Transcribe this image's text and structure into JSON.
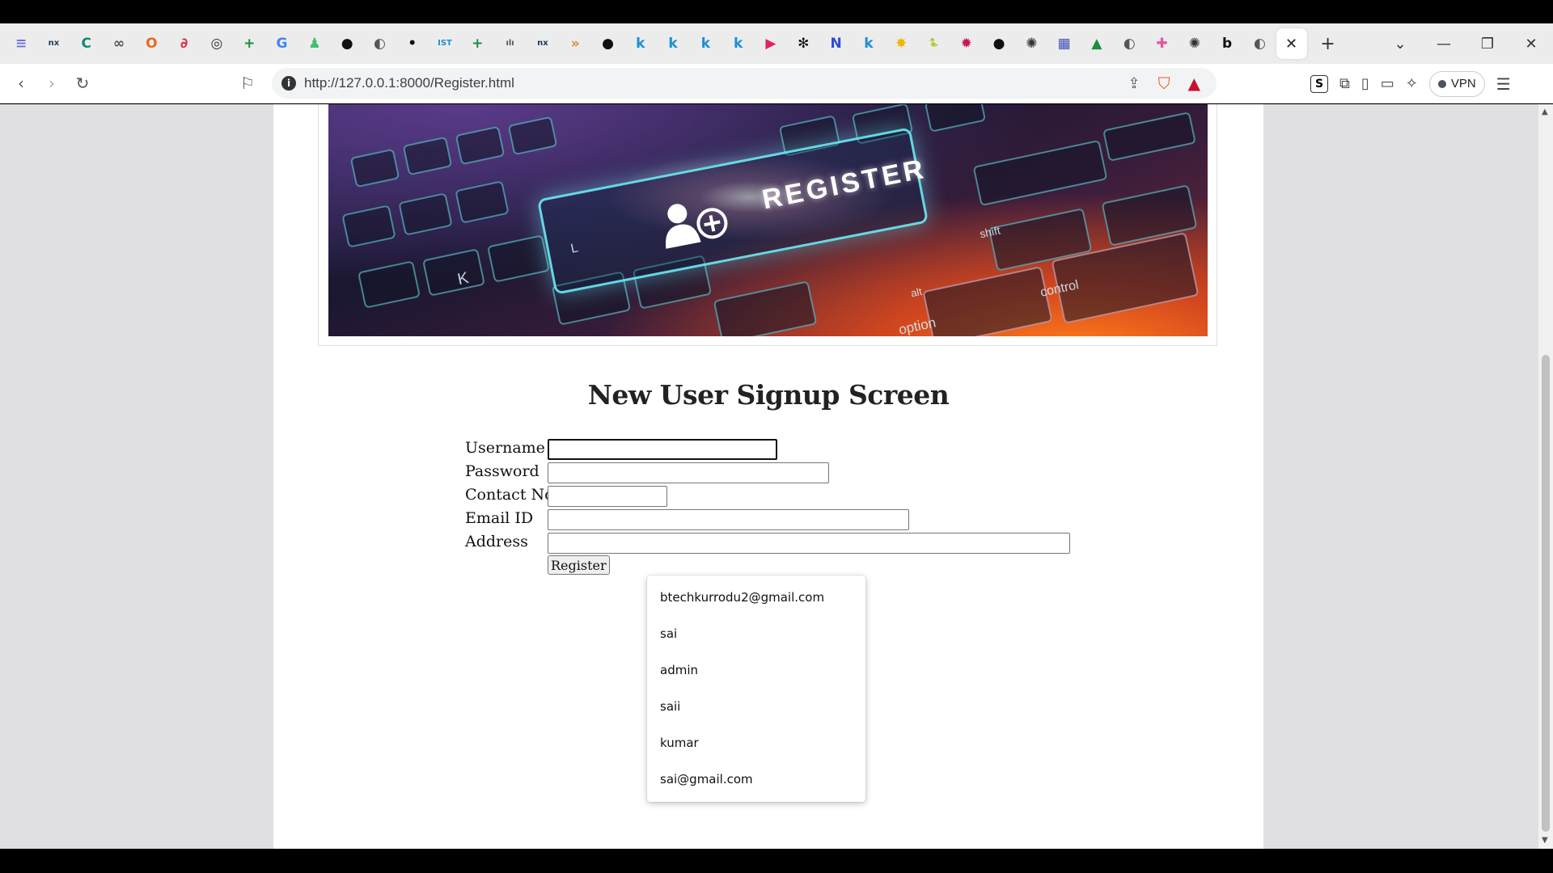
{
  "browser": {
    "url": "http://127.0.0.1:8000/Register.html",
    "vpn_label": "VPN",
    "tabs": [
      {
        "icon": "lines-icon",
        "color": "#6b73d8",
        "glyph": "≡"
      },
      {
        "icon": "nx-icon",
        "color": "#1d3a5a",
        "glyph": "nx"
      },
      {
        "icon": "c-icon",
        "color": "#0e8a74",
        "glyph": "C"
      },
      {
        "icon": "bike-icon",
        "color": "#555",
        "glyph": "∞"
      },
      {
        "icon": "office-icon",
        "color": "#e86a1f",
        "glyph": "O"
      },
      {
        "icon": "script-icon",
        "color": "#d62b3a",
        "glyph": "∂"
      },
      {
        "icon": "glasses-icon",
        "color": "#333",
        "glyph": "◎"
      },
      {
        "icon": "sheets-icon",
        "color": "#1e8e3e",
        "glyph": "+"
      },
      {
        "icon": "google-icon",
        "color": "#4285f4",
        "glyph": "G"
      },
      {
        "icon": "person-icon",
        "color": "#3fbf6f",
        "glyph": "♟"
      },
      {
        "icon": "github-icon",
        "color": "#111",
        "glyph": "●"
      },
      {
        "icon": "globe-icon",
        "color": "#555",
        "glyph": "◐"
      },
      {
        "icon": "dot-icon",
        "color": "#111",
        "glyph": "•"
      },
      {
        "icon": "ist-icon",
        "color": "#1a8fd6",
        "glyph": "IST"
      },
      {
        "icon": "sheets2-icon",
        "color": "#1e8e3e",
        "glyph": "+"
      },
      {
        "icon": "cisco-icon",
        "color": "#555",
        "glyph": "ılı"
      },
      {
        "icon": "nx2-icon",
        "color": "#1d3a5a",
        "glyph": "nx"
      },
      {
        "icon": "arrows-icon",
        "color": "#e08a2a",
        "glyph": "»"
      },
      {
        "icon": "github2-icon",
        "color": "#111",
        "glyph": "●"
      },
      {
        "icon": "k1-icon",
        "color": "#1a8fd6",
        "glyph": "k"
      },
      {
        "icon": "k2-icon",
        "color": "#1a8fd6",
        "glyph": "k"
      },
      {
        "icon": "k3-icon",
        "color": "#1a8fd6",
        "glyph": "k"
      },
      {
        "icon": "k4-icon",
        "color": "#1a8fd6",
        "glyph": "k"
      },
      {
        "icon": "record-icon",
        "color": "#e2245b",
        "glyph": "▶"
      },
      {
        "icon": "chatgpt-icon",
        "color": "#111",
        "glyph": "✻"
      },
      {
        "icon": "n-icon",
        "color": "#2b4bd8",
        "glyph": "N"
      },
      {
        "icon": "k5-icon",
        "color": "#1a8fd6",
        "glyph": "k"
      },
      {
        "icon": "star-icon",
        "color": "#f4b400",
        "glyph": "✸"
      },
      {
        "icon": "python-icon",
        "color": "#3b78a8",
        "glyph": "🐍"
      },
      {
        "icon": "gear-icon",
        "color": "#c2185b",
        "glyph": "✹"
      },
      {
        "icon": "github3-icon",
        "color": "#111",
        "glyph": "●"
      },
      {
        "icon": "openai-icon",
        "color": "#333",
        "glyph": "✺"
      },
      {
        "icon": "layout-icon",
        "color": "#3a4bb8",
        "glyph": "▦"
      },
      {
        "icon": "drive-icon",
        "color": "#1e8e3e",
        "glyph": "▲"
      },
      {
        "icon": "globe2-icon",
        "color": "#555",
        "glyph": "◐"
      },
      {
        "icon": "colorful-icon",
        "color": "#e05aa0",
        "glyph": "✚"
      },
      {
        "icon": "openai2-icon",
        "color": "#333",
        "glyph": "✺"
      },
      {
        "icon": "b-icon",
        "color": "#111",
        "glyph": "b"
      },
      {
        "icon": "globe3-icon",
        "color": "#555",
        "glyph": "◐"
      }
    ]
  },
  "page": {
    "banner": {
      "text": "REGISTER",
      "keys": [
        "shift",
        "control",
        "alt",
        "option",
        "K",
        "L"
      ]
    },
    "title": "New User Signup Screen",
    "form": {
      "username_label": "Username",
      "password_label": "Password",
      "contact_label": "Contact No",
      "email_label": "Email ID",
      "address_label": "Address",
      "register_button": "Register"
    },
    "autocomplete": [
      "btechkurrodu2@gmail.com",
      "sai",
      "admin",
      "saii",
      "kumar",
      "sai@gmail.com"
    ]
  }
}
